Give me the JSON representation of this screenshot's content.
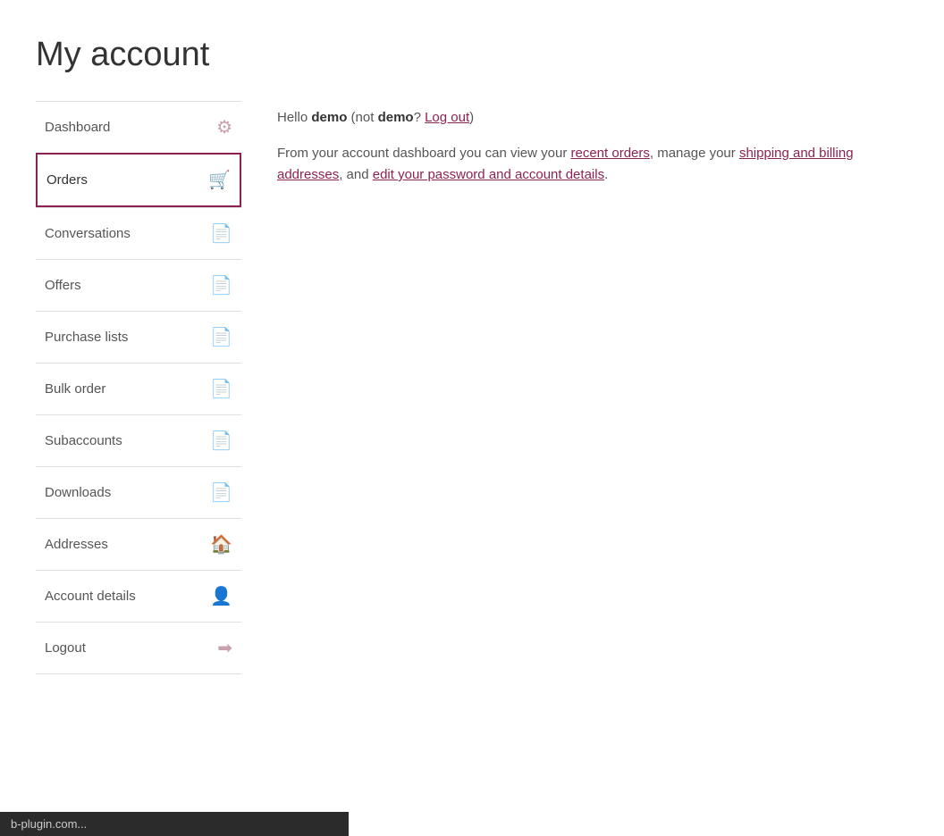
{
  "page": {
    "title": "My account"
  },
  "greeting": {
    "hello": "Hello ",
    "username": "demo",
    "not_text": " (not ",
    "username2": "demo",
    "question_text": "? ",
    "logout_link": "Log out",
    "close_paren": ")"
  },
  "description": {
    "text_before": "From your account dashboard you can view your ",
    "recent_orders_link": "recent orders",
    "text_middle1": ", manage your ",
    "shipping_link": "shipping and billing addresses",
    "text_middle2": ", and ",
    "edit_link": "edit your password and account details",
    "text_end": "."
  },
  "sidebar": {
    "items": [
      {
        "id": "dashboard",
        "label": "Dashboard",
        "icon": "dashboard",
        "active": false
      },
      {
        "id": "orders",
        "label": "Orders",
        "icon": "orders",
        "active": true
      },
      {
        "id": "conversations",
        "label": "Conversations",
        "icon": "conversations",
        "active": false
      },
      {
        "id": "offers",
        "label": "Offers",
        "icon": "offers",
        "active": false
      },
      {
        "id": "purchase-lists",
        "label": "Purchase lists",
        "icon": "purchase-lists",
        "active": false
      },
      {
        "id": "bulk-order",
        "label": "Bulk order",
        "icon": "bulk-order",
        "active": false
      },
      {
        "id": "subaccounts",
        "label": "Subaccounts",
        "icon": "subaccounts",
        "active": false
      },
      {
        "id": "downloads",
        "label": "Downloads",
        "icon": "downloads",
        "active": false
      },
      {
        "id": "addresses",
        "label": "Addresses",
        "icon": "addresses",
        "active": false
      },
      {
        "id": "account-details",
        "label": "Account details",
        "icon": "account-details",
        "active": false
      },
      {
        "id": "logout",
        "label": "Logout",
        "icon": "logout",
        "active": false
      }
    ]
  },
  "statusbar": {
    "text": "b-plugin.com..."
  }
}
